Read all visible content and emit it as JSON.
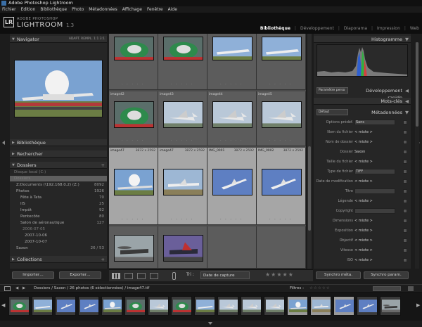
{
  "window": {
    "title": "Adobe Photoshop Lightroom"
  },
  "menu": [
    "Fichier",
    "Edition",
    "Bibliothèque",
    "Photo",
    "Métadonnées",
    "Affichage",
    "Fenêtre",
    "Aide"
  ],
  "identity": {
    "brand_top": "ADOBE PHOTOSHOP",
    "brand_name": "LIGHTROOM",
    "version": "1.3",
    "logo": "LR"
  },
  "modules": [
    {
      "label": "Bibliothèque",
      "active": true
    },
    {
      "label": "Développement",
      "active": false
    },
    {
      "label": "Diaporama",
      "active": false
    },
    {
      "label": "Impression",
      "active": false
    },
    {
      "label": "Web",
      "active": false
    }
  ],
  "left": {
    "navigator": {
      "label": "Navigator",
      "zoom": "ADAPT.  REMPL.  1:1  3:1"
    },
    "library": "Bibliothèque",
    "find": "Rechercher",
    "folders": {
      "label": "Dossiers",
      "add": "+",
      "rows": [
        {
          "label": "Disque local (C:)",
          "value": "",
          "dim": true
        },
        {
          "label": "Dossiers",
          "value": "",
          "dim": true
        },
        {
          "label": "Z:Documents (\\192.168.0.2) (Z:)",
          "value": "8092",
          "dim": false
        },
        {
          "label": "Photos",
          "value": "1926",
          "dim": false
        },
        {
          "label": "Fête à Tata",
          "value": "70",
          "dim": false
        },
        {
          "label": "IIS",
          "value": "25",
          "dim": false
        },
        {
          "label": "Impôt",
          "value": "92",
          "dim": false
        },
        {
          "label": "Pentecôte",
          "value": "80",
          "dim": false
        },
        {
          "label": "Salon de aéronautique",
          "value": "127",
          "dim": false
        },
        {
          "label": "2006-07-05",
          "value": "",
          "dim": true
        },
        {
          "label": "2007-10-06",
          "value": "",
          "dim": false
        },
        {
          "label": "2007-10-07",
          "value": "",
          "dim": false
        },
        {
          "label": "Saxon",
          "value": "26 / 53",
          "dim": false
        }
      ]
    },
    "collections": "Collections",
    "import_btn": "Importer…",
    "export_btn": "Exporter…"
  },
  "grid": {
    "rows": [
      {
        "type": "dark",
        "cells": [
          {
            "meta": "",
            "dims": "",
            "thumb": "cockpit"
          },
          {
            "meta": "",
            "dims": "",
            "thumb": "cockpit"
          },
          {
            "meta": "",
            "dims": "",
            "thumb": "jetline"
          },
          {
            "meta": "",
            "dims": "",
            "thumb": "jetline"
          }
        ]
      },
      {
        "type": "dark",
        "cells": [
          {
            "meta": "image42",
            "dims": "",
            "thumb": "cockpit"
          },
          {
            "meta": "image43",
            "dims": "",
            "thumb": "fighter"
          },
          {
            "meta": "image44",
            "dims": "",
            "thumb": "fighter"
          },
          {
            "meta": "image45",
            "dims": "",
            "thumb": "fighter"
          }
        ]
      },
      {
        "type": "light",
        "cells": [
          {
            "meta": "image47",
            "dims": "3872 x 2592",
            "thumb": "balloon"
          },
          {
            "meta": "image47",
            "dims": "3872 x 2592",
            "thumb": "plane"
          },
          {
            "meta": "IMG_0001",
            "dims": "3872 x 2592",
            "thumb": "sky"
          },
          {
            "meta": "IMG_0002",
            "dims": "3872 x 2592",
            "thumb": "sky"
          }
        ]
      },
      {
        "type": "dark",
        "cells": [
          {
            "meta": "",
            "dims": "",
            "thumb": "chopper"
          },
          {
            "meta": "",
            "dims": "",
            "thumb": "chopper2"
          },
          {
            "meta": "",
            "dims": "",
            "thumb": ""
          },
          {
            "meta": "",
            "dims": "",
            "thumb": ""
          }
        ]
      }
    ]
  },
  "toolbar": {
    "sort_label": "Tri :",
    "sort_value": "Date de capture",
    "stars": "★★★★★"
  },
  "right": {
    "histogram": "Histogramme",
    "quick_dev": "Développement rapide",
    "quick_select": "Paramètre perso",
    "keywords": "Mots-clés",
    "metadata": "Métadonnées",
    "meta_select": "Défaut",
    "fields": [
      {
        "label": "Options prédéf.",
        "value": "Sans"
      },
      {
        "label": "Nom du fichier",
        "value": "< mixte >"
      },
      {
        "label": "Nom de dossier",
        "value": "< mixte >"
      },
      {
        "label": "Dossier",
        "value": "Saxon"
      },
      {
        "label": "Taille du fichier",
        "value": "< mixte >"
      },
      {
        "label": "Type de fichier",
        "value": "TIFF"
      },
      {
        "label": "Date de modification",
        "value": "< mixte >"
      },
      {
        "label": "Titre",
        "value": ""
      },
      {
        "label": "Légende",
        "value": "< mixte >"
      },
      {
        "label": "Copyright",
        "value": ""
      },
      {
        "label": "Dimensions",
        "value": "< mixte >"
      },
      {
        "label": "Exposition",
        "value": "< mixte >"
      },
      {
        "label": "Objectif",
        "value": "< mixte >"
      },
      {
        "label": "Vitesse",
        "value": "< mixte >"
      },
      {
        "label": "ISO",
        "value": "< mixte >"
      }
    ],
    "sync_meta": "Synchro méta.",
    "sync_settings": "Synchro param."
  },
  "filmstrip": {
    "path": "Dossiers / Saxon / 26 photos (6 sélectionnées) / image47.tif",
    "filter_label": "Filtres :",
    "count": 17
  }
}
